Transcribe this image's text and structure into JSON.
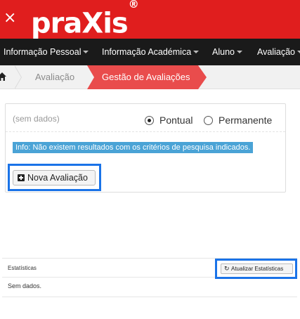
{
  "header": {
    "close_label": "×",
    "logo_text": "praXis",
    "logo_mark": "®",
    "background_color": "#e01e1e"
  },
  "navbar": {
    "items": [
      {
        "label": "Informação Pessoal"
      },
      {
        "label": "Informação Académica"
      },
      {
        "label": "Aluno"
      },
      {
        "label": "Avaliação"
      }
    ]
  },
  "breadcrumb": {
    "home_icon": "home-icon",
    "items": [
      {
        "label": "Avaliação"
      },
      {
        "label": "Gestão de Avaliações",
        "active": true
      }
    ],
    "active_color": "#e94c4c"
  },
  "filter_panel": {
    "no_data_text": "(sem dados)",
    "radio_options": [
      {
        "label": "Pontual",
        "selected": true
      },
      {
        "label": "Permanente",
        "selected": false
      }
    ],
    "info_message": "Info: Não existem resultados com os critérios de pesquisa indicados.",
    "info_color": "#4aa3d6",
    "new_button_label": "Nova Avaliação",
    "new_button_icon": "plus-square-icon"
  },
  "stats_panel": {
    "title": "Estatísticas",
    "refresh_button_label": "Atualizar Estatísticas",
    "refresh_icon": "refresh-icon",
    "body_text": "Sem dados."
  },
  "highlight_color": "#1a73e8"
}
